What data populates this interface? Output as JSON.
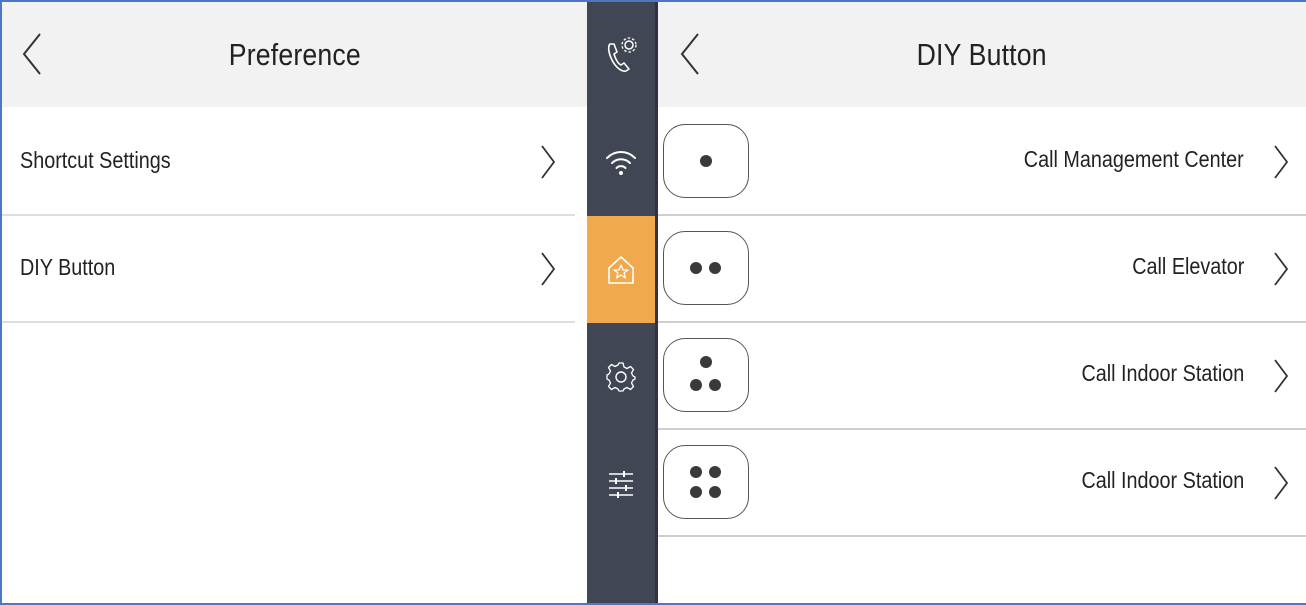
{
  "left": {
    "title": "Preference",
    "items": [
      {
        "label": "Shortcut Settings"
      },
      {
        "label": "DIY Button"
      }
    ]
  },
  "sidebar": {
    "active_color": "#f0a94c",
    "background_color": "#404653",
    "items": [
      {
        "icon": "call-settings-icon"
      },
      {
        "icon": "wifi-icon"
      },
      {
        "icon": "home-star-icon",
        "active": true
      },
      {
        "icon": "gear-icon"
      },
      {
        "icon": "sliders-icon"
      }
    ]
  },
  "right": {
    "title": "DIY Button",
    "items": [
      {
        "label": "Call Management Center",
        "dots": 1
      },
      {
        "label": "Call Elevator",
        "dots": 2
      },
      {
        "label": "Call Indoor Station",
        "dots": 3
      },
      {
        "label": "Call Indoor Station",
        "dots": 4
      }
    ]
  }
}
